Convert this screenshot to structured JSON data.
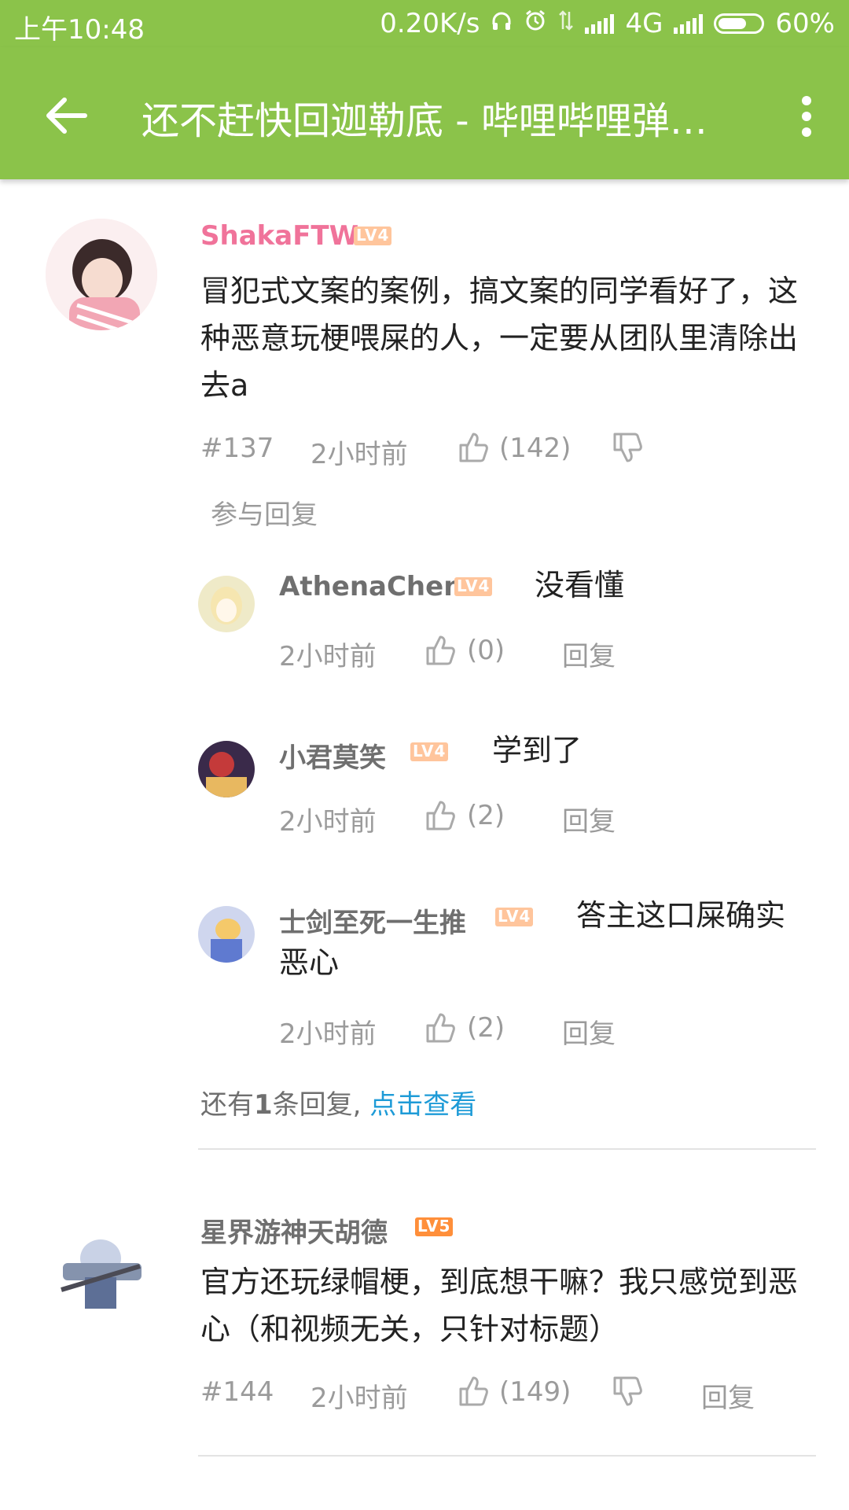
{
  "status_bar": {
    "time": "上午10:48",
    "speed": "0.20K/s",
    "network": "4G",
    "battery": "60%"
  },
  "header": {
    "title": "还不赶快回迦勒底 - 哔哩哔哩弹幕..."
  },
  "comments": [
    {
      "username": "ShakaFTW",
      "level": "LV4",
      "text": "冒犯式文案的案例，搞文案的同学看好了，这种恶意玩梗喂屎的人，一定要从团队里清除出去a",
      "floor": "#137",
      "time": "2小时前",
      "likes": "(142)",
      "reply_action": "参与回复",
      "replies": [
        {
          "username": "AthenaChen",
          "level": "LV4",
          "text": "没看懂",
          "time": "2小时前",
          "likes": "(0)",
          "reply": "回复"
        },
        {
          "username": "小君莫笑",
          "level": "LV4",
          "text": "学到了",
          "time": "2小时前",
          "likes": "(2)",
          "reply": "回复"
        },
        {
          "username": "士剑至死一生推",
          "level": "LV4",
          "text": "答主这口屎确实恶心",
          "time": "2小时前",
          "likes": "(2)",
          "reply": "回复"
        }
      ],
      "more_replies": {
        "prefix": "还有",
        "count": "1",
        "suffix": "条回复,",
        "link": "点击查看"
      }
    },
    {
      "username": "星界游神天胡德",
      "level": "LV5",
      "text": "官方还玩绿帽梗，到底想干嘛？我只感觉到恶心（和视频无关，只针对标题）",
      "floor": "#144",
      "time": "2小时前",
      "likes": "(149)",
      "reply_action": "回复"
    }
  ],
  "colors": {
    "accent": "#8bc34a",
    "username_pink": "#f0739a",
    "link": "#1e9bd7",
    "meta": "#9b9b9b"
  }
}
